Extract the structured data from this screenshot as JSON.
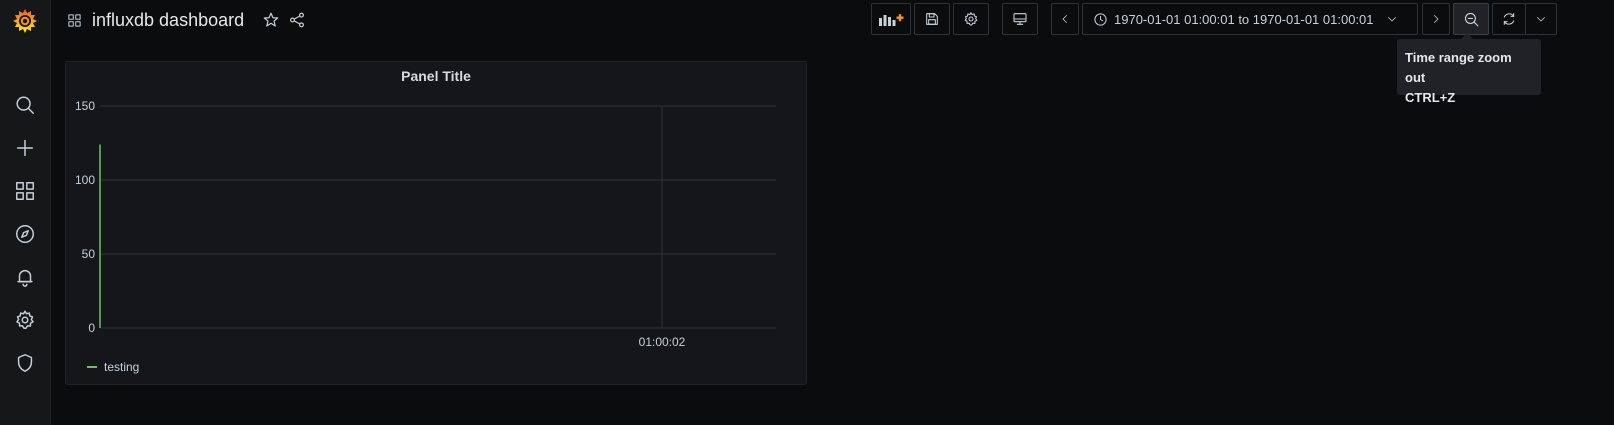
{
  "app": {
    "sidebar": {
      "logo": "grafana-logo",
      "items": [
        {
          "name": "search",
          "icon": "search-icon"
        },
        {
          "name": "create",
          "icon": "plus-icon"
        },
        {
          "name": "dashboards",
          "icon": "apps-icon"
        },
        {
          "name": "explore",
          "icon": "compass-icon"
        },
        {
          "name": "alerting",
          "icon": "bell-icon"
        },
        {
          "name": "configuration",
          "icon": "gear-icon"
        },
        {
          "name": "server-admin",
          "icon": "shield-icon"
        }
      ]
    }
  },
  "header": {
    "title": "influxdb dashboard",
    "time_range": "1970-01-01 01:00:01 to 1970-01-01 01:00:01",
    "tooltip": {
      "line1": "Time range zoom out",
      "line2": "CTRL+Z"
    }
  },
  "panel": {
    "title": "Panel Title",
    "legend": [
      {
        "name": "testing",
        "color": "#73bf69"
      }
    ]
  },
  "chart_data": {
    "type": "line",
    "title": "Panel Title",
    "xlabel": "",
    "ylabel": "",
    "x_ticks": [
      "01:00:02"
    ],
    "y_ticks": [
      0,
      50,
      100,
      150
    ],
    "ylim": [
      0,
      150
    ],
    "grid": true,
    "legend_position": "bottom-left",
    "series": [
      {
        "name": "testing",
        "color": "#73bf69",
        "points": [
          {
            "x": "01:00:00",
            "y": 0
          },
          {
            "x": "01:00:00",
            "y": 124
          }
        ]
      }
    ]
  },
  "colors": {
    "background": "#0b0c0e",
    "panel": "#141619",
    "accent_orange": "#f7941d",
    "series_green": "#73bf69"
  }
}
